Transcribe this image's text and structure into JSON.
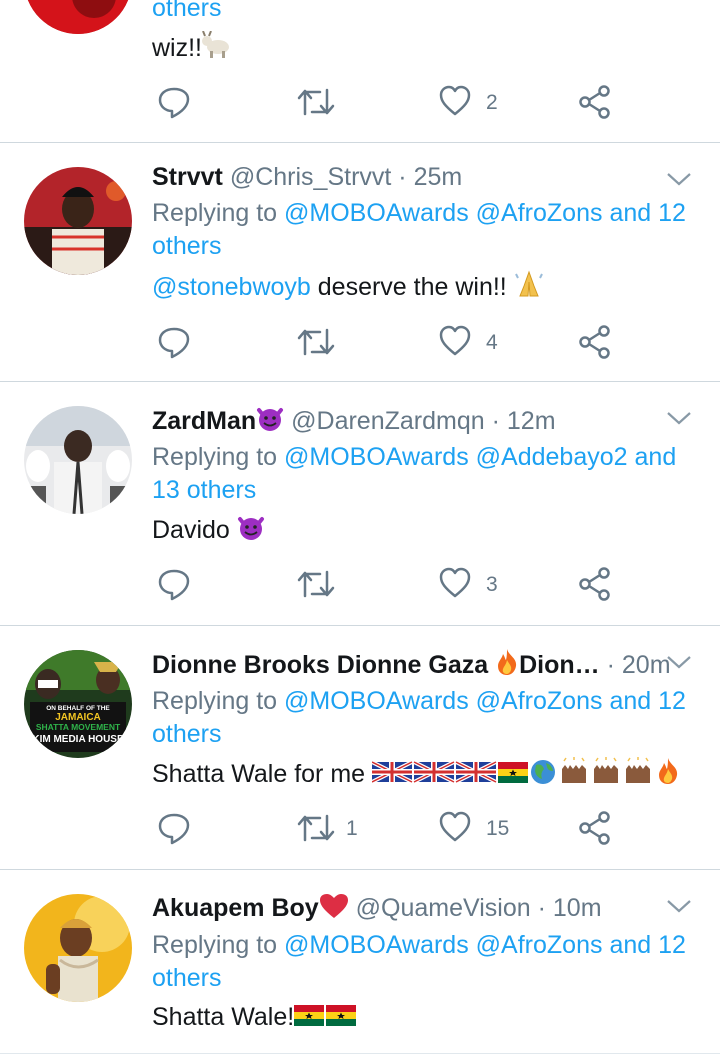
{
  "colors": {
    "accent": "#1da1f2",
    "muted": "#657786",
    "text": "#14171a",
    "divider": "#cfd8de"
  },
  "top_tweet": {
    "reply_tail": "others",
    "text": "wiz!!",
    "text_emoji": "goat-emoji",
    "likes": "2"
  },
  "tweets": [
    {
      "name": "Strvvt",
      "handle": "@Chris_Strvvt",
      "time": "25m",
      "replying_prefix": "Replying to",
      "reply_mention_1": "@MOBOAwards",
      "reply_mention_2": "@AfroZons",
      "reply_and": "and 12",
      "reply_line2": "others",
      "text_mention": "@stonebwoyb",
      "text": " deserve the win!!",
      "text_emoji": "folded-hands-emoji",
      "retweets": "",
      "likes": "4"
    },
    {
      "name": "ZardMan",
      "name_emoji": "smiling-devil-emoji",
      "handle": "@DarenZardmqn",
      "time": "12m",
      "replying_prefix": "Replying to",
      "reply_mention_1": "@MOBOAwards",
      "reply_mention_2": "@Addebayo2",
      "reply_and": "and",
      "reply_line2": "13 others",
      "text": "Davido",
      "text_emoji": "smiling-devil-emoji",
      "retweets": "",
      "likes": "3"
    },
    {
      "name": "Dionne Brooks Dionne Gaza",
      "name_emoji": "fire-emoji",
      "name_tail": "Dion…",
      "time": "20m",
      "replying_prefix": "Replying to",
      "reply_mention_1": "@MOBOAwards",
      "reply_mention_2": "@AfroZons",
      "reply_and": "and 12",
      "reply_line2": "others",
      "text": "Shatta Wale for me",
      "text_emoji": "uk-flag-x3, ghana-flag, globe, raised-hands-x3, fire",
      "retweets": "1",
      "likes": "15",
      "avatar_text": [
        "ON BEHALF OF THE",
        "JAMAICA",
        "SHATTA MOVEMENT",
        "KIM MEDIA HOUSE"
      ]
    },
    {
      "name": "Akuapem Boy",
      "name_emoji": "red-heart-emoji",
      "handle": "@QuameVision",
      "time": "10m",
      "replying_prefix": "Replying to",
      "reply_mention_1": "@MOBOAwards",
      "reply_mention_2": "@AfroZons",
      "reply_and": "and 12",
      "reply_line2": "others",
      "text": "Shatta Wale!",
      "text_emoji": "ghana-flag-x2"
    }
  ]
}
